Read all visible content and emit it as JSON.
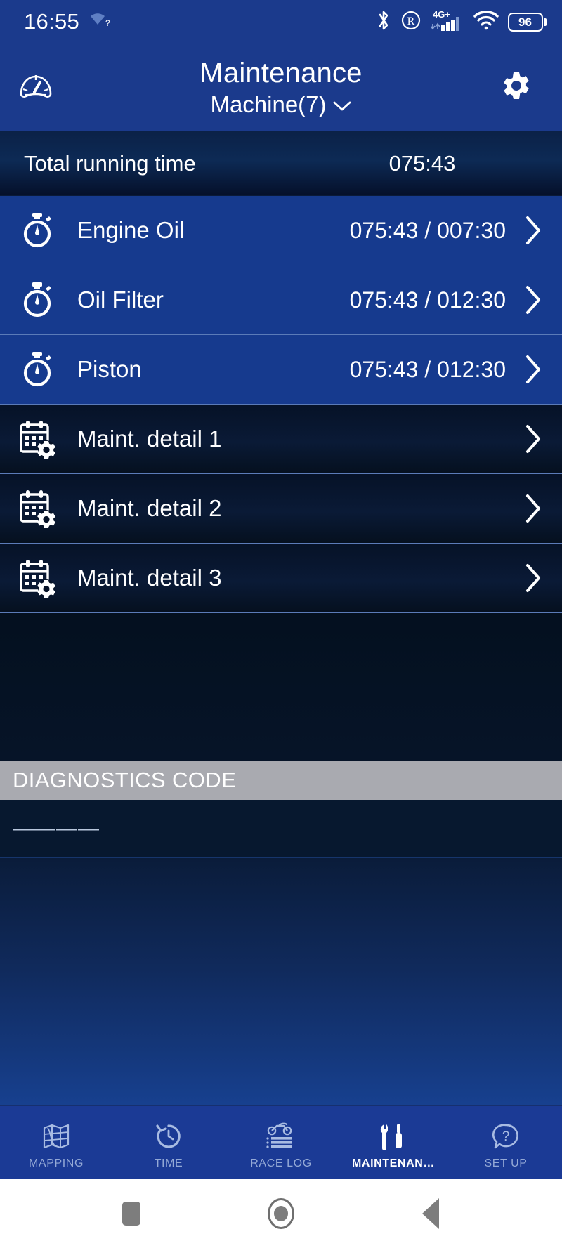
{
  "status_bar": {
    "time": "16:55",
    "icons": [
      "wifi-question-icon",
      "bluetooth-icon",
      "roaming-icon",
      "4g-plus-signal-icon",
      "wifi-icon"
    ],
    "network_label": "4G+",
    "battery_percent": "96"
  },
  "header": {
    "left_icon": "speedometer-icon",
    "title": "Maintenance",
    "subtitle": "Machine(7)",
    "subtitle_chevron": "chevron-down-icon",
    "right_icon": "gear-icon"
  },
  "total": {
    "label": "Total running time",
    "value": "075:43"
  },
  "maintenance_items": [
    {
      "icon": "stopwatch-icon",
      "label": "Engine Oil",
      "value": "075:43 / 007:30",
      "style": "blue"
    },
    {
      "icon": "stopwatch-icon",
      "label": "Oil Filter",
      "value": "075:43 / 012:30",
      "style": "blue"
    },
    {
      "icon": "stopwatch-icon",
      "label": "Piston",
      "value": "075:43 / 012:30",
      "style": "blue"
    },
    {
      "icon": "calendar-gear-icon",
      "label": "Maint. detail 1",
      "value": "",
      "style": "dark"
    },
    {
      "icon": "calendar-gear-icon",
      "label": "Maint. detail 2",
      "value": "",
      "style": "dark"
    },
    {
      "icon": "calendar-gear-icon",
      "label": "Maint. detail 3",
      "value": "",
      "style": "dark"
    }
  ],
  "diagnostics": {
    "header": "DIAGNOSTICS CODE",
    "code": "————"
  },
  "tabs": [
    {
      "label": "MAPPING",
      "icon": "map-icon",
      "active": false
    },
    {
      "label": "TIME",
      "icon": "clock-rotate-icon",
      "active": false
    },
    {
      "label": "RACE LOG",
      "icon": "motorcycle-log-icon",
      "active": false
    },
    {
      "label": "MAINTENAN…",
      "icon": "tools-icon",
      "active": true
    },
    {
      "label": "SET UP",
      "icon": "question-bubble-icon",
      "active": false
    }
  ],
  "navbar": {
    "recents": "recents-square-icon",
    "home": "home-circle-icon",
    "back": "back-triangle-icon"
  },
  "colors": {
    "header_blue": "#1b3a8c",
    "row_blue": "#163a8e",
    "row_dark": "#061227",
    "diag_gray": "#a9aab0",
    "tabbar_blue": "#1b3a95",
    "accent_white": "#ffffff"
  }
}
